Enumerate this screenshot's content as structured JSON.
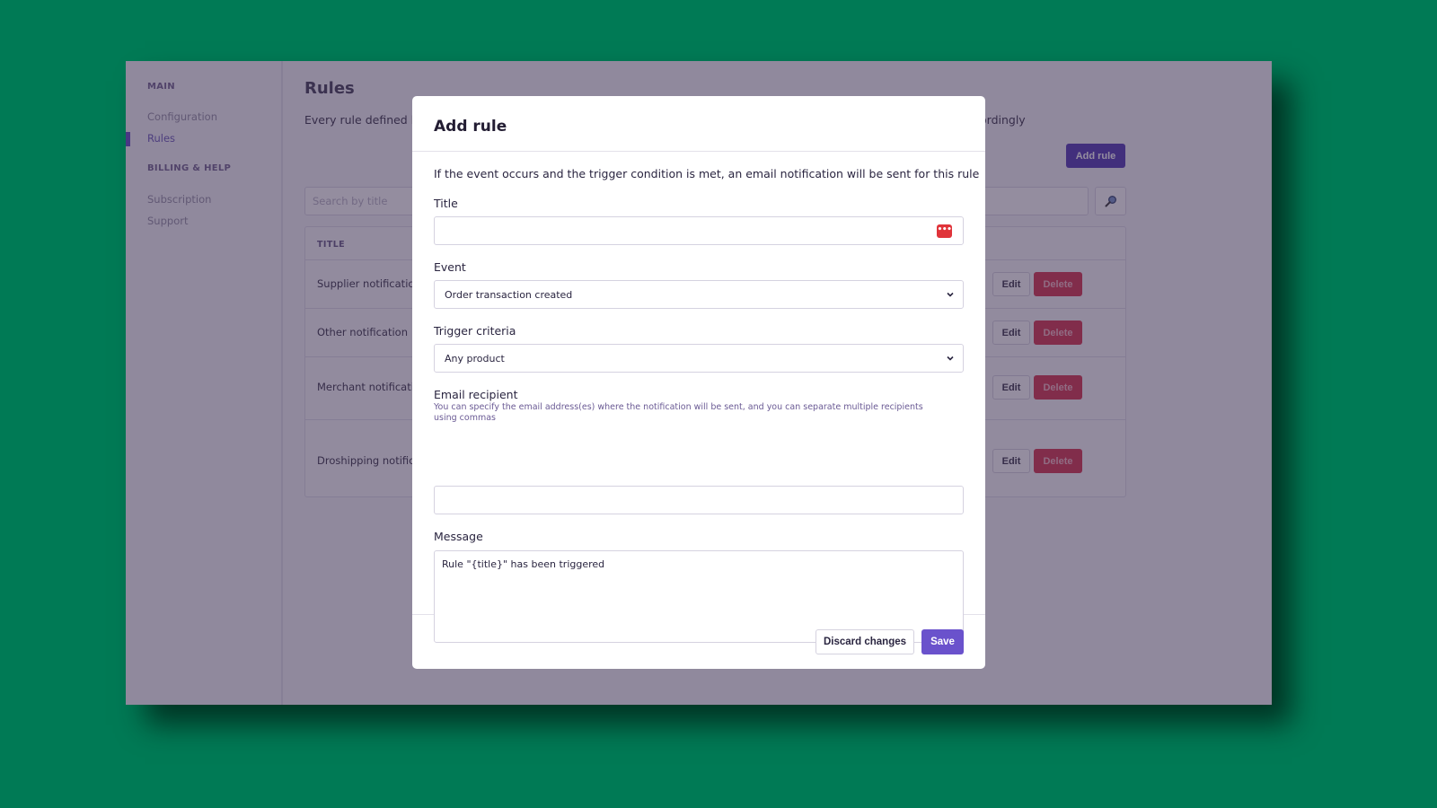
{
  "sidebar": {
    "sections": [
      {
        "label": "MAIN",
        "items": [
          {
            "label": "Configuration",
            "active": false
          },
          {
            "label": "Rules",
            "active": true
          }
        ]
      },
      {
        "label": "BILLING & HELP",
        "items": [
          {
            "label": "Subscription",
            "active": false
          },
          {
            "label": "Support",
            "active": false
          }
        ]
      }
    ]
  },
  "main": {
    "title": "Rules",
    "description_visible_start": "Every rule defined b",
    "description_visible_end": "ordingly",
    "add_rule_label": "Add rule",
    "search": {
      "placeholder": "Search by title",
      "value": "",
      "button_icon": "search-icon"
    },
    "table": {
      "column_header": "TITLE",
      "rows": [
        {
          "title": "Supplier notification",
          "edit_label": "Edit",
          "delete_label": "Delete"
        },
        {
          "title": "Other notification",
          "edit_label": "Edit",
          "delete_label": "Delete"
        },
        {
          "title": "Merchant notificatio",
          "edit_label": "Edit",
          "delete_label": "Delete"
        },
        {
          "title": "Droshipping notifica",
          "edit_label": "Edit",
          "delete_label": "Delete"
        }
      ]
    }
  },
  "modal": {
    "title": "Add rule",
    "intro": "If the event occurs and the trigger condition is met, an email notification will be sent for this rule",
    "fields": {
      "title": {
        "label": "Title",
        "value": "",
        "icon": "password-manager-icon"
      },
      "event": {
        "label": "Event",
        "value": "Order transaction created"
      },
      "trigger": {
        "label": "Trigger criteria",
        "value": "Any product"
      },
      "email": {
        "label": "Email recipient",
        "help": "You can specify the email address(es) where the notification will be sent, and you can separate multiple recipients using commas",
        "value": ""
      },
      "message": {
        "label": "Message",
        "value": "Rule \"{title}\" has been triggered"
      }
    },
    "discard_label": "Discard changes",
    "save_label": "Save"
  },
  "colors": {
    "background": "#007a55",
    "accent": "#5a40c4",
    "save": "#6a52cc",
    "danger": "#d42b45"
  }
}
